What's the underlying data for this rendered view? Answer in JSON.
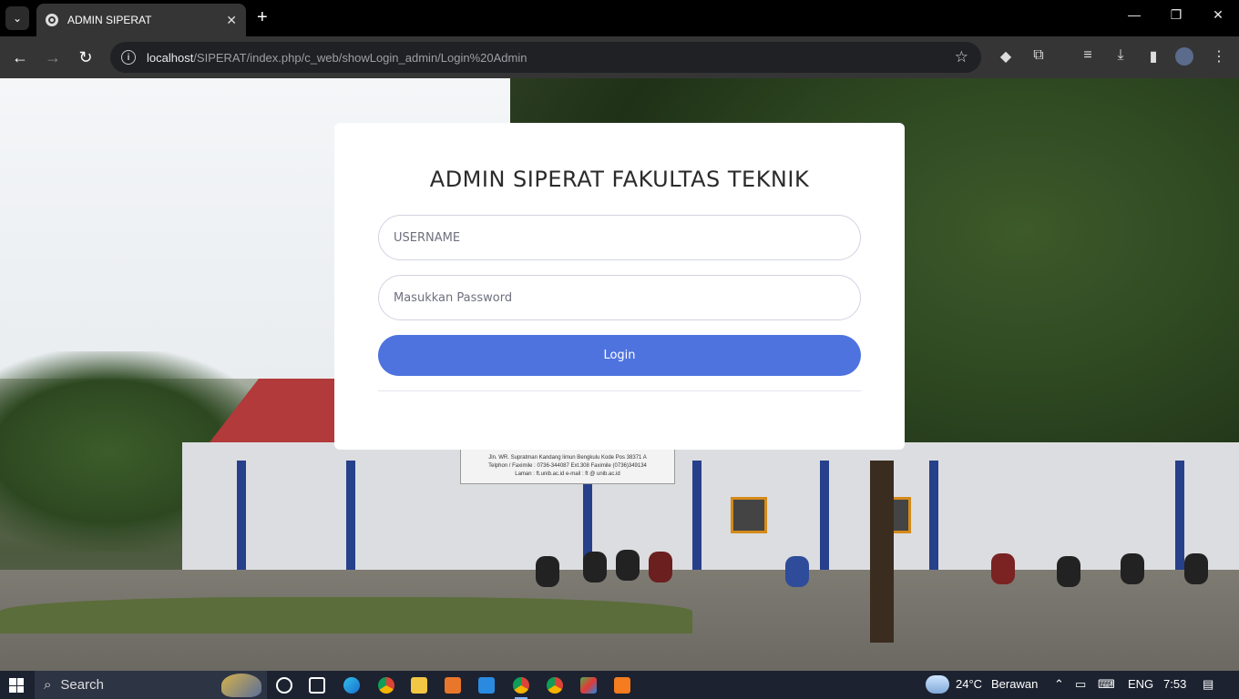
{
  "browser": {
    "tab_title": "ADMIN SIPERAT",
    "tab_close": "✕",
    "new_tab": "+",
    "url_host": "localhost",
    "url_path": "/SIPERAT/index.php/c_web/showLogin_admin/Login%20Admin",
    "window_controls": {
      "minimize": "—",
      "restore": "❐",
      "close": "✕"
    }
  },
  "login": {
    "heading": "ADMIN SIPERAT FAKULTAS TEKNIK",
    "username_placeholder": "USERNAME",
    "password_placeholder": "Masukkan Password",
    "login_button": "Login"
  },
  "background": {
    "signboard_lines": [
      "Jln. WR. Supratman Kandang limun Bengkulu Kode Pos 38371 A",
      "Telphon / Faximile : 0736-344087 Ext.308 Faximile (0736)349134",
      "Laman : ft.unib.ac.id e-mail : ft @ unib.ac.id"
    ]
  },
  "taskbar": {
    "search_label": "Search",
    "weather_temp": "24°C",
    "weather_text": "Berawan",
    "language": "ENG",
    "time": "7:53"
  }
}
